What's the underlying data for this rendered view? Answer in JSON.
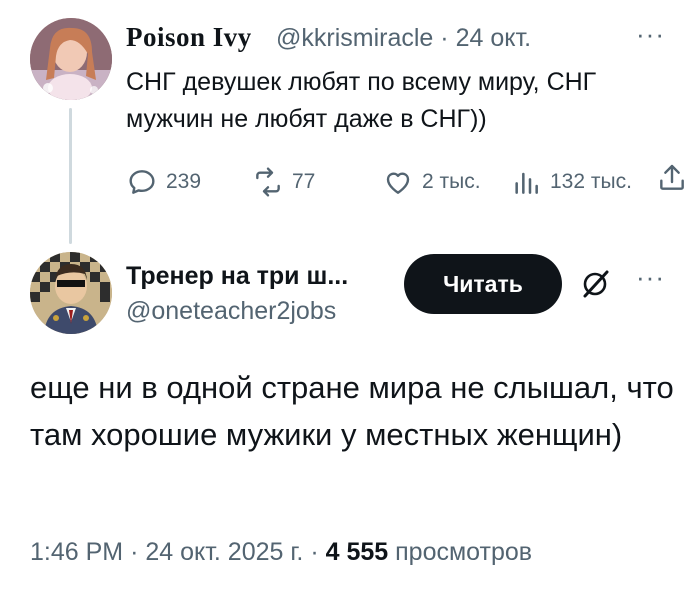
{
  "tweet1": {
    "author_name": "Poison Ivy",
    "handle": "@kkrismiracle",
    "separator": "·",
    "date": "24 окт.",
    "more": "···",
    "text": "СНГ девушек любят по всему миру, СНГ мужчин не любят даже в СНГ))",
    "stats": {
      "replies": "239",
      "reposts": "77",
      "likes": "2 тыс.",
      "views": "132 тыс."
    }
  },
  "tweet2": {
    "author_name": "Тренер на три ш...",
    "handle": "@oneteacher2jobs",
    "follow_label": "Читать",
    "more": "···",
    "text": "еще ни в одной стране мира не слышал, что там хорошие мужики у местных женщин)",
    "time": "1:46 PM",
    "separator": "·",
    "date": "24 окт. 2025 г.",
    "views_count": "4 555",
    "views_label": "просмотров"
  },
  "colors": {
    "text": "#0f1419",
    "secondary": "#536471",
    "button_bg": "#0f1419",
    "thread_line": "#cfd9de"
  }
}
